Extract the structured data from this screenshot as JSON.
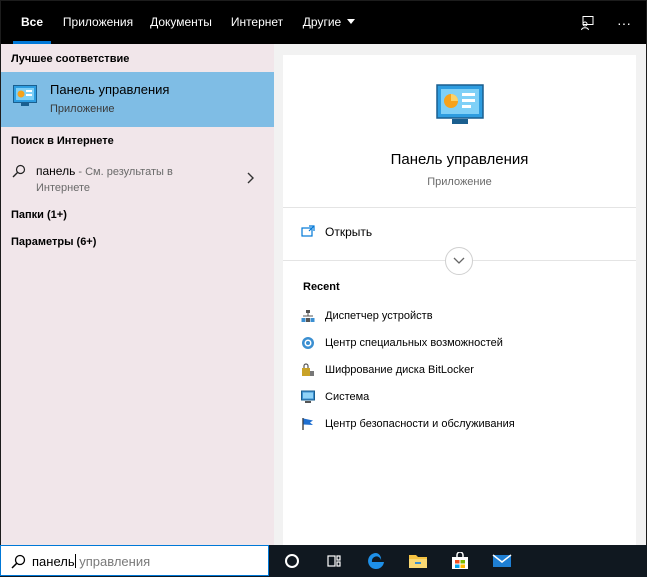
{
  "tabs": [
    {
      "label": "Все",
      "active": true
    },
    {
      "label": "Приложения",
      "active": false
    },
    {
      "label": "Документы",
      "active": false
    },
    {
      "label": "Интернет",
      "active": false
    },
    {
      "label": "Другие",
      "active": false
    }
  ],
  "top_icons": [
    "feedback-icon",
    "more-icon"
  ],
  "more_glyph": "···",
  "left": {
    "best_match_header": "Лучшее соответствие",
    "best_match": {
      "title": "Панель управления",
      "subtitle": "Приложение"
    },
    "web_header": "Поиск в Интернете",
    "web_result": {
      "query": "панель",
      "hint": " - См. результаты в",
      "hint_line2": "Интернете"
    },
    "folders": "Папки (1+)",
    "settings": "Параметры (6+)"
  },
  "right": {
    "title": "Панель управления",
    "subtitle": "Приложение",
    "open_label": "Открыть",
    "recent_header": "Recent",
    "recent": [
      {
        "label": "Диспетчер устройств",
        "icon": "device-manager-icon"
      },
      {
        "label": "Центр специальных возможностей",
        "icon": "accessibility-icon"
      },
      {
        "label": "Шифрование диска BitLocker",
        "icon": "bitlocker-icon"
      },
      {
        "label": "Система",
        "icon": "system-icon"
      },
      {
        "label": "Центр безопасности и обслуживания",
        "icon": "security-flag-icon"
      }
    ]
  },
  "search": {
    "typed": "панель",
    "suggestion": " управления"
  },
  "taskbar_icons": [
    "cortana-icon",
    "task-view-icon",
    "edge-icon",
    "file-explorer-icon",
    "store-icon",
    "mail-icon"
  ],
  "colors": {
    "accent": "#0078d7",
    "selection": "#7fbde5",
    "left_bg": "#f1e6ea",
    "dark": "#000000"
  }
}
